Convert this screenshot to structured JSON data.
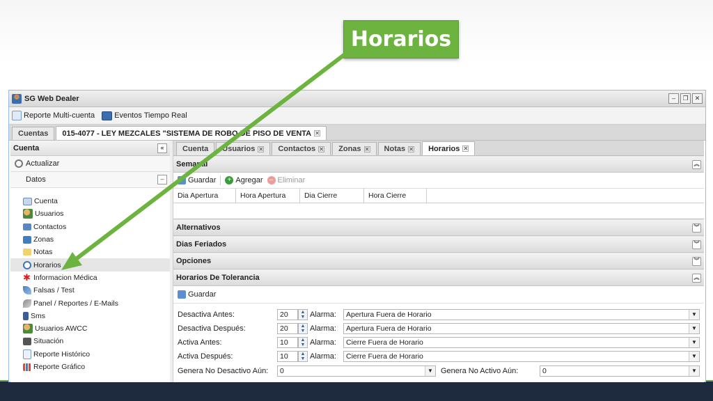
{
  "slide": {
    "callout": "Horarios"
  },
  "window": {
    "title": "SG Web Dealer"
  },
  "toolbar": {
    "items": [
      "Reporte Multi-cuenta",
      "Eventos Tiempo Real"
    ]
  },
  "outer_tabs": [
    {
      "label": "Cuentas"
    },
    {
      "label": "015-4077 - LEY MEZCALES \"SISTEMA DE ROBO DE PISO DE VENTA"
    }
  ],
  "left": {
    "header": "Cuenta",
    "refresh": "Actualizar",
    "section": "Datos",
    "nav": [
      "Cuenta",
      "Usuarios",
      "Contactos",
      "Zonas",
      "Notas",
      "Horarios",
      "Informacion Médica",
      "Falsas / Test",
      "Panel / Reportes / E-Mails",
      "Sms",
      "Usuarios AWCC",
      "Situación",
      "Reporte Histórico",
      "Reporte Gráfico"
    ]
  },
  "inner_tabs": [
    "Cuenta",
    "Usuarios",
    "Contactos",
    "Zonas",
    "Notas",
    "Horarios"
  ],
  "semanal": {
    "title": "Semanal",
    "toolbar": [
      "Guardar",
      "Agregar",
      "Eliminar"
    ],
    "columns": [
      "Dia Apertura",
      "Hora Apertura",
      "Dia Cierre",
      "Hora Cierre"
    ]
  },
  "sections": [
    "Alternativos",
    "Dias Feriados",
    "Opciones"
  ],
  "tolerancia": {
    "title": "Horarios De Tolerancia",
    "save": "Guardar",
    "alarm_label": "Alarma:",
    "rows": [
      {
        "label": "Desactiva Antes:",
        "value": "20",
        "alarm": "Apertura Fuera de Horario"
      },
      {
        "label": "Desactiva Después:",
        "value": "20",
        "alarm": "Apertura Fuera de Horario"
      },
      {
        "label": "Activa Antes:",
        "value": "10",
        "alarm": "Cierre Fuera de Horario"
      },
      {
        "label": "Activa Después:",
        "value": "10",
        "alarm": "Cierre Fuera de Horario"
      }
    ],
    "genera_no_desactivo": {
      "label": "Genera No Desactivo Aún:",
      "value": "0"
    },
    "genera_no_activo": {
      "label": "Genera No Activo Aún:",
      "value": "0"
    }
  },
  "colors": {
    "accent_green": "#6db33f",
    "bottom_bar": "#1e2a3e"
  }
}
